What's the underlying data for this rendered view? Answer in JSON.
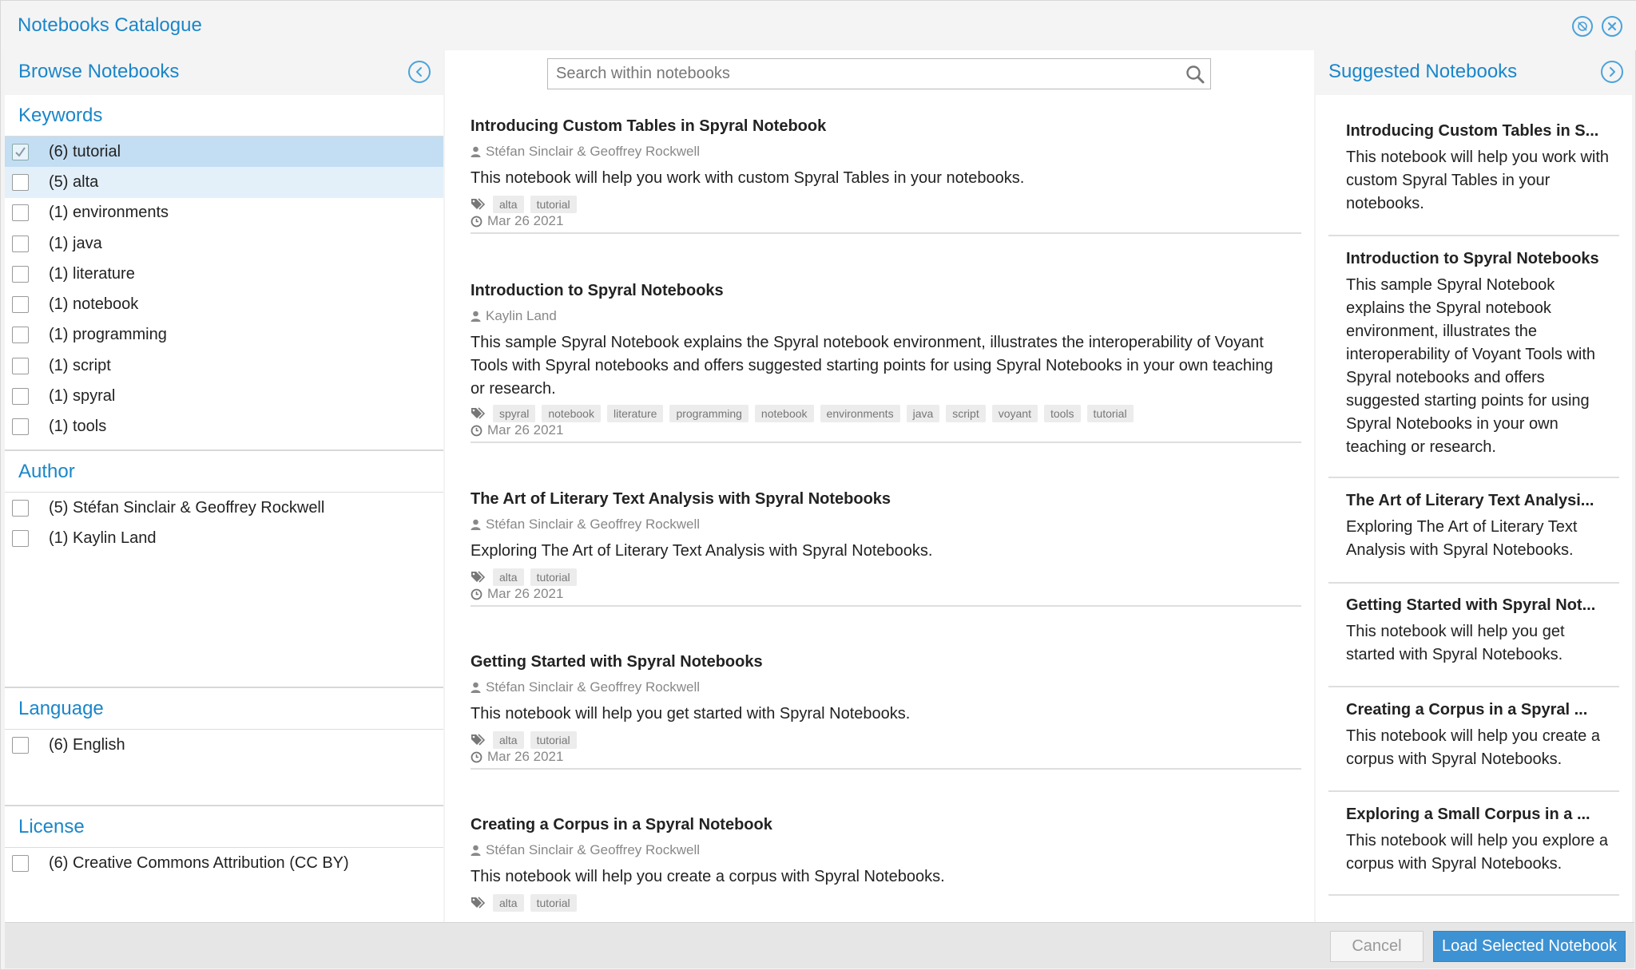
{
  "window": {
    "title": "Notebooks Catalogue",
    "icons": [
      "no-sync-icon",
      "close-icon"
    ]
  },
  "left_panel": {
    "title": "Browse Notebooks",
    "collapse_icon": "chevron-left-icon",
    "facets": {
      "keywords": {
        "title": "Keywords",
        "items": [
          {
            "label": "(6) tutorial",
            "checked": true
          },
          {
            "label": "(5) alta",
            "checked": false
          },
          {
            "label": "(1) environments",
            "checked": false
          },
          {
            "label": "(1) java",
            "checked": false
          },
          {
            "label": "(1) literature",
            "checked": false
          },
          {
            "label": "(1) notebook",
            "checked": false
          },
          {
            "label": "(1) programming",
            "checked": false
          },
          {
            "label": "(1) script",
            "checked": false
          },
          {
            "label": "(1) spyral",
            "checked": false
          },
          {
            "label": "(1) tools",
            "checked": false
          }
        ]
      },
      "author": {
        "title": "Author",
        "items": [
          {
            "label": "(5) Stéfan Sinclair & Geoffrey Rockwell",
            "checked": false
          },
          {
            "label": "(1) Kaylin Land",
            "checked": false
          }
        ]
      },
      "language": {
        "title": "Language",
        "items": [
          {
            "label": "(6) English",
            "checked": false
          }
        ]
      },
      "license": {
        "title": "License",
        "items": [
          {
            "label": "(6) Creative Commons Attribution (CC BY)",
            "checked": false
          }
        ]
      }
    }
  },
  "search": {
    "placeholder": "Search within notebooks"
  },
  "notebooks": [
    {
      "title": "Introducing Custom Tables in Spyral Notebook",
      "author": "Stéfan Sinclair & Geoffrey Rockwell",
      "description": "This notebook will help you work with custom Spyral Tables in your notebooks.",
      "tags": [
        "alta",
        "tutorial"
      ],
      "date": "Mar 26 2021"
    },
    {
      "title": "Introduction to Spyral Notebooks",
      "author": "Kaylin Land",
      "description": "This sample Spyral Notebook explains the Spyral notebook environment, illustrates the interoperability of Voyant Tools with Spyral notebooks and offers suggested starting points for using Spyral Notebooks in your own teaching or research.",
      "tags": [
        "spyral",
        "notebook",
        "literature",
        "programming",
        "notebook",
        "environments",
        "java",
        "script",
        "voyant",
        "tools",
        "tutorial"
      ],
      "date": "Mar 26 2021"
    },
    {
      "title": "The Art of Literary Text Analysis with Spyral Notebooks",
      "author": "Stéfan Sinclair & Geoffrey Rockwell",
      "description": "Exploring The Art of Literary Text Analysis with Spyral Notebooks.",
      "tags": [
        "alta",
        "tutorial"
      ],
      "date": "Mar 26 2021"
    },
    {
      "title": "Getting Started with Spyral Notebooks",
      "author": "Stéfan Sinclair & Geoffrey Rockwell",
      "description": "This notebook will help you get started with Spyral Notebooks.",
      "tags": [
        "alta",
        "tutorial"
      ],
      "date": "Mar 26 2021"
    },
    {
      "title": "Creating a Corpus in a Spyral Notebook",
      "author": "Stéfan Sinclair & Geoffrey Rockwell",
      "description": "This notebook will help you create a corpus with Spyral Notebooks.",
      "tags": [
        "alta",
        "tutorial"
      ],
      "date": ""
    }
  ],
  "right_panel": {
    "title": "Suggested Notebooks",
    "collapse_icon": "chevron-right-icon",
    "items": [
      {
        "title": "Introducing Custom Tables in S...",
        "description": "This notebook will help you work with custom Spyral Tables in your notebooks."
      },
      {
        "title": "Introduction to Spyral Notebooks",
        "description": "This sample Spyral Notebook explains the Spyral notebook environment, illustrates the interoperability of Voyant Tools with Spyral notebooks and offers suggested starting points for using Spyral Notebooks in your own teaching or research."
      },
      {
        "title": "The Art of Literary Text Analysi...",
        "description": "Exploring The Art of Literary Text Analysis with Spyral Notebooks."
      },
      {
        "title": "Getting Started with Spyral Not...",
        "description": "This notebook will help you get started with Spyral Notebooks."
      },
      {
        "title": "Creating a Corpus in a Spyral ...",
        "description": "This notebook will help you create a corpus with Spyral Notebooks."
      },
      {
        "title": "Exploring a Small Corpus in a ...",
        "description": "This notebook will help you explore a corpus with Spyral Notebooks."
      }
    ]
  },
  "footer": {
    "cancel_label": "Cancel",
    "load_label": "Load Selected Notebook"
  },
  "colors": {
    "accent": "#1a86c9",
    "selected_row": "#c3ddf2",
    "hover_row": "#e3f0fa",
    "primary_button": "#3d92d3"
  }
}
